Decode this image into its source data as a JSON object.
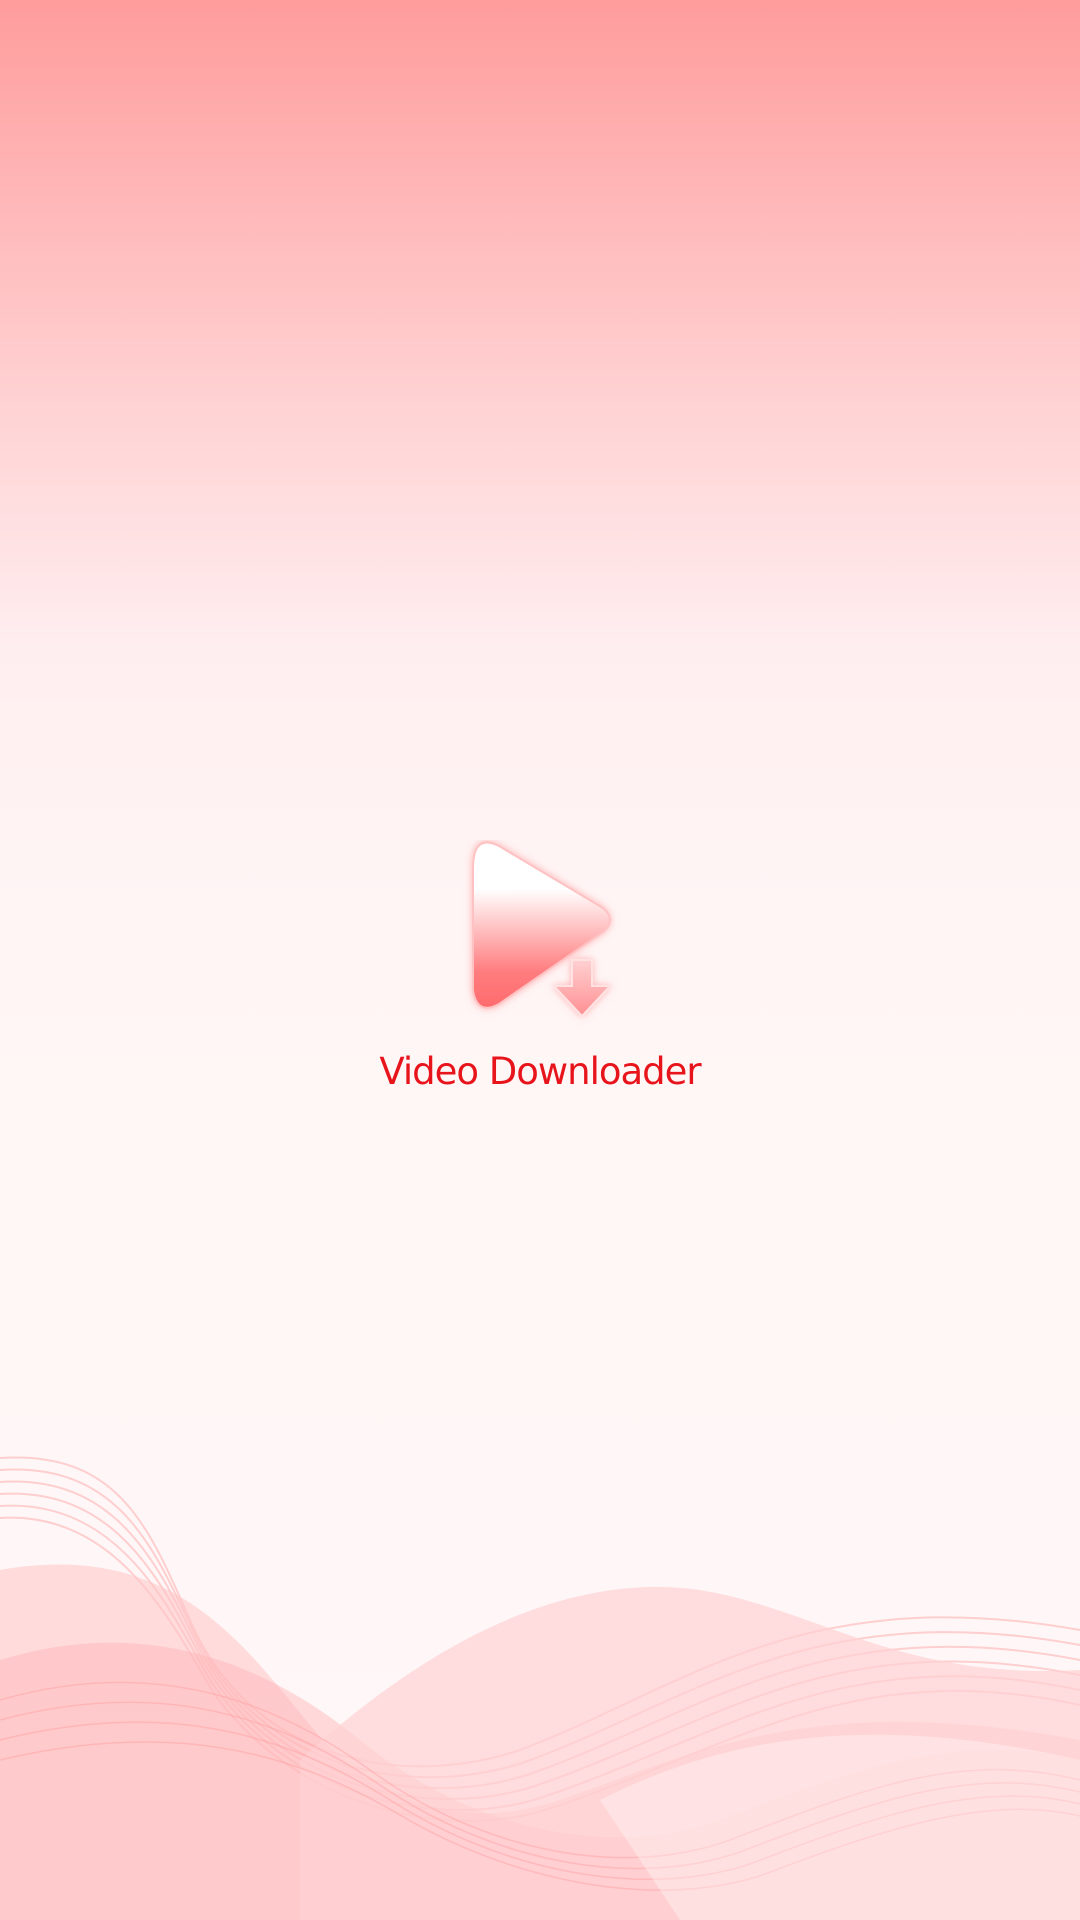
{
  "app": {
    "name": "Video Downloader",
    "logo_icon": "play-download-icon"
  },
  "colors": {
    "brand_red": "#e8141c",
    "background_top": "#ff9c9c",
    "background_bottom": "#fff8f8",
    "wave": "#ffb3b5"
  }
}
